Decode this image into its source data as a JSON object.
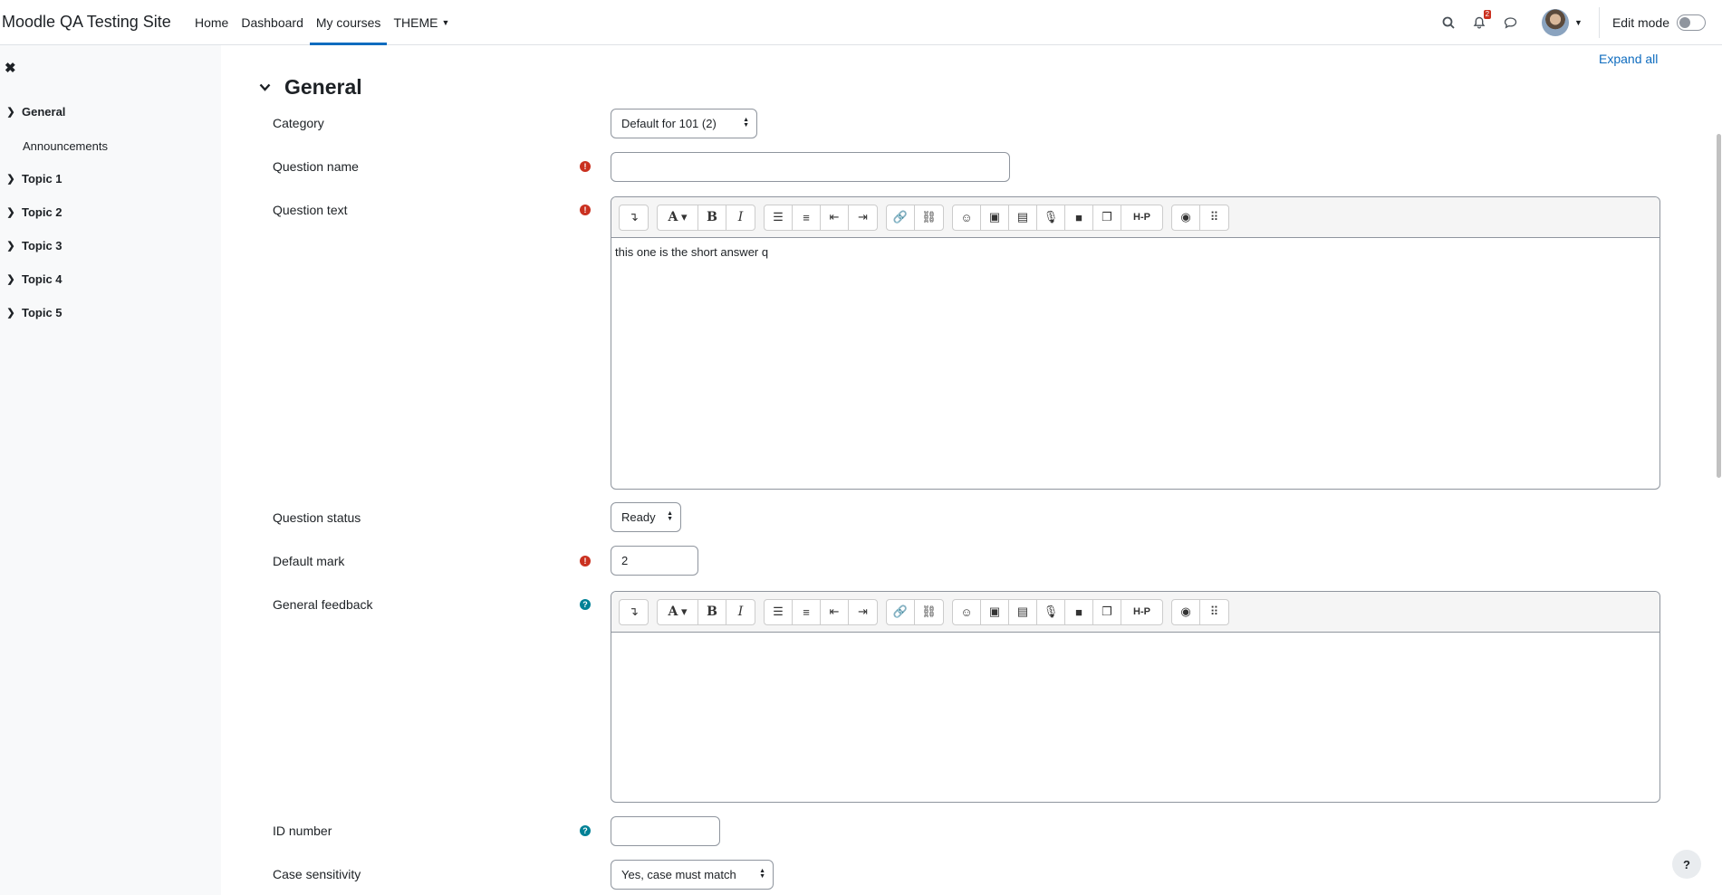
{
  "site": {
    "name": "Moodle QA Testing Site"
  },
  "nav": {
    "items": [
      {
        "label": "Home"
      },
      {
        "label": "Dashboard"
      },
      {
        "label": "My courses"
      },
      {
        "label": "THEME"
      }
    ],
    "notification_count": "2",
    "edit_mode_label": "Edit mode"
  },
  "drawer": {
    "items": [
      {
        "label": "General"
      },
      {
        "label": "Announcements"
      },
      {
        "label": "Topic 1"
      },
      {
        "label": "Topic 2"
      },
      {
        "label": "Topic 3"
      },
      {
        "label": "Topic 4"
      },
      {
        "label": "Topic 5"
      }
    ]
  },
  "main": {
    "expand_all": "Expand all",
    "section_title": "General",
    "fields": {
      "category": {
        "label": "Category",
        "value": "Default for 101 (2)"
      },
      "question_name": {
        "label": "Question name",
        "value": ""
      },
      "question_text": {
        "label": "Question text",
        "value": "this one is the short answer q"
      },
      "question_status": {
        "label": "Question status",
        "value": "Ready"
      },
      "default_mark": {
        "label": "Default mark",
        "value": "2"
      },
      "general_feedback": {
        "label": "General feedback",
        "value": ""
      },
      "id_number": {
        "label": "ID number",
        "value": ""
      },
      "case_sensitivity": {
        "label": "Case sensitivity",
        "value": "Yes, case must match"
      }
    }
  },
  "icons": {
    "required": "exclamation-circle-icon",
    "help": "question-circle-icon"
  },
  "colors": {
    "accent": "#0f6cbf",
    "required": "#ca3120",
    "help": "#008196"
  }
}
